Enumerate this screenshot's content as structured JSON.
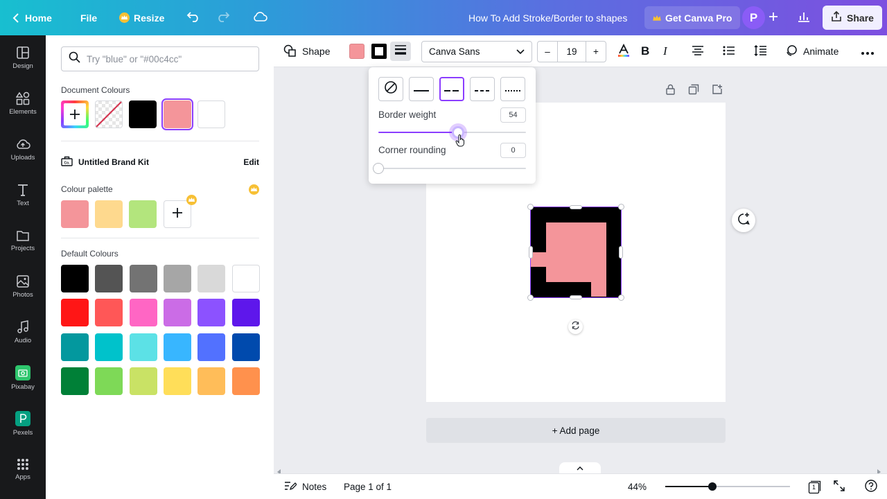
{
  "topbar": {
    "home_label": "Home",
    "file_label": "File",
    "resize_label": "Resize",
    "doc_title": "How To Add Stroke/Border to shapes",
    "pro_label": "Get Canva Pro",
    "avatar_initial": "P",
    "share_label": "Share"
  },
  "rail": [
    {
      "label": "Design",
      "icon": "design-icon"
    },
    {
      "label": "Elements",
      "icon": "elements-icon"
    },
    {
      "label": "Uploads",
      "icon": "uploads-icon"
    },
    {
      "label": "Text",
      "icon": "text-icon"
    },
    {
      "label": "Projects",
      "icon": "projects-icon"
    },
    {
      "label": "Photos",
      "icon": "photos-icon"
    },
    {
      "label": "Audio",
      "icon": "audio-icon"
    },
    {
      "label": "Pixabay",
      "icon": "pixabay-icon",
      "color": "#2ec66d"
    },
    {
      "label": "Pexels",
      "icon": "pexels-icon",
      "color": "#05a081"
    },
    {
      "label": "Apps",
      "icon": "apps-icon"
    }
  ],
  "panel": {
    "search_placeholder": "Try \"blue\" or \"#00c4cc\"",
    "document_colours_label": "Document Colours",
    "document_colours": [
      "add",
      "transparent",
      "#000000",
      "#f4959a",
      "#ffffff"
    ],
    "brand_kit_label": "Untitled Brand Kit",
    "brand_edit_label": "Edit",
    "palette_label": "Colour palette",
    "palette": [
      "#f4959a",
      "#fed98e",
      "#b3e57d"
    ],
    "default_label": "Default Colours",
    "default_colours": [
      [
        "#000000",
        "#545454",
        "#737373",
        "#a6a6a6",
        "#d9d9d9",
        "#ffffff"
      ],
      [
        "#ff1616",
        "#ff5757",
        "#ff66c4",
        "#cb6ce6",
        "#8c52ff",
        "#5e17eb"
      ],
      [
        "#03989e",
        "#00c2cb",
        "#5ce1e6",
        "#38b6ff",
        "#5271ff",
        "#004aad"
      ],
      [
        "#008037",
        "#7ed957",
        "#c9e265",
        "#ffde59",
        "#ffbd59",
        "#ff914d"
      ]
    ]
  },
  "toolbar": {
    "shape_label": "Shape",
    "fill_color": "#f4959a",
    "font_name": "Canva Sans",
    "font_size": "19",
    "animate_label": "Animate"
  },
  "popover": {
    "border_weight_label": "Border weight",
    "border_weight_value": "54",
    "border_weight_fraction": 0.54,
    "corner_rounding_label": "Corner rounding",
    "corner_rounding_value": "0",
    "corner_rounding_fraction": 0,
    "selected_style": 2
  },
  "canvas": {
    "add_page_label": "+ Add page",
    "shape_fill": "#f4959a",
    "shape_border": "#000000"
  },
  "bottombar": {
    "notes_label": "Notes",
    "page_label": "Page 1 of 1",
    "zoom_label": "44%",
    "zoom_fraction": 0.38,
    "pages_count": "1"
  },
  "accent_color": "#8b3dff"
}
